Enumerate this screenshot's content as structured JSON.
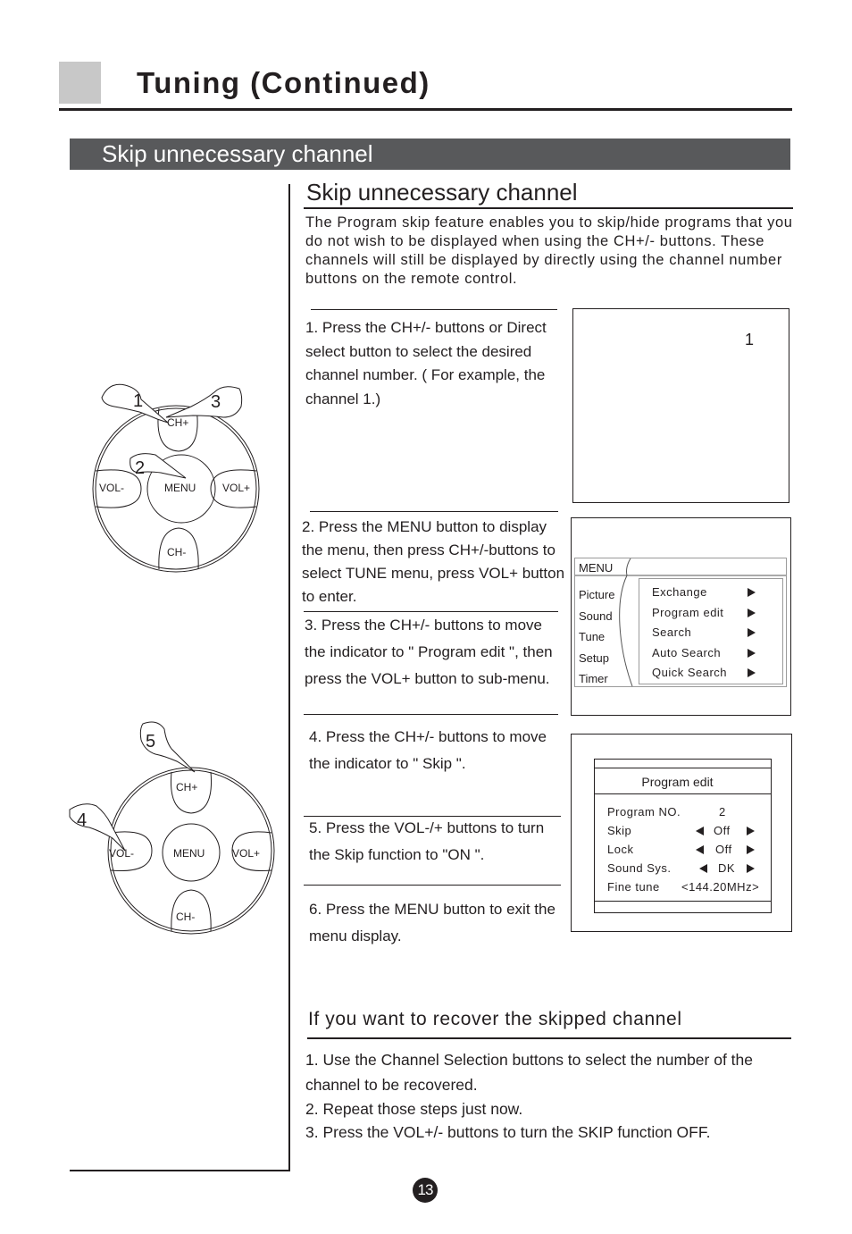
{
  "header": {
    "title": "Tuning (Continued)",
    "section_bar": "Skip unnecessary channel"
  },
  "main": {
    "subtitle": "Skip unnecessary channel",
    "intro": "The Program skip feature enables you to skip/hide programs that you do not wish to be displayed when using the CH+/- buttons. These channels will still be displayed by directly using the channel number buttons on the remote control.",
    "steps": [
      {
        "text": "1. Press the CH+/- buttons or Direct select button to select the desired channel number. ( For example, the channel 1.)"
      },
      {
        "text": "2. Press the MENU button to display the menu, then press CH+/-buttons to select TUNE menu, press VOL+ button to enter."
      },
      {
        "text": "3. Press the CH+/- buttons to move the indicator to \" Program edit \", then press the VOL+ button to sub-menu."
      },
      {
        "text": "4. Press the CH+/- buttons to move the indicator to \" Skip \"."
      },
      {
        "text": "5. Press the VOL-/+ buttons to turn the Skip function to \"ON \"."
      },
      {
        "text": "6. Press the MENU button to  exit the menu display."
      }
    ]
  },
  "remote": {
    "ch_up": "CH+",
    "ch_down": "CH-",
    "vol_down": "VOL-",
    "vol_up": "VOL+",
    "menu": "MENU",
    "pointers_top": [
      "1",
      "2",
      "3"
    ],
    "pointers_bottom": [
      "4",
      "5"
    ]
  },
  "screen1": {
    "channel_number": "1"
  },
  "screen2": {
    "menu_label": "MENU",
    "tabs": [
      "Picture",
      "Sound",
      "Tune",
      "Setup",
      "Timer"
    ],
    "items": [
      "Exchange",
      "Program edit",
      "Search",
      "Auto Search",
      "Quick Search"
    ]
  },
  "screen3": {
    "title": "Program edit",
    "rows": [
      {
        "label": "Program NO.",
        "value": "2",
        "arrows": false
      },
      {
        "label": "Skip",
        "value": "Off",
        "arrows": true
      },
      {
        "label": "Lock",
        "value": "Off",
        "arrows": true
      },
      {
        "label": "Sound Sys.",
        "value": "DK",
        "arrows": true
      },
      {
        "label": "Fine tune",
        "value": "<144.20MHz>",
        "arrows": false
      }
    ]
  },
  "recover": {
    "title": "If you want to recover the skipped channel",
    "lines": [
      "1. Use the Channel Selection buttons to select the  number of the channel  to be recovered.",
      "2. Repeat those steps just now.",
      "3. Press the VOL+/- buttons to turn the  SKIP function  OFF."
    ]
  },
  "footer": {
    "page_number": "13"
  }
}
